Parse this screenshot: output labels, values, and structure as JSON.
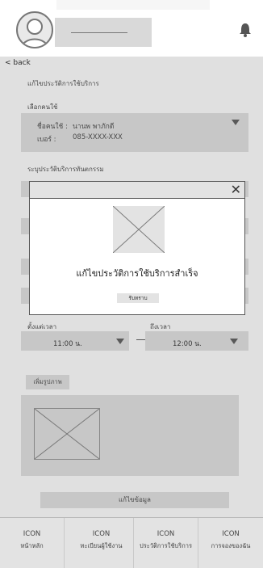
{
  "header": {
    "back_label": "< back",
    "name_placeholder": ""
  },
  "page": {
    "title": "แก้ไขประวัติการใช้บริการ",
    "select_user_label": "เลือกคนใช้",
    "maid_name_label": "ชื่อคนใช้ :",
    "maid_name_value": "นานพ พาภักดี",
    "phone_label": "เบอร์ :",
    "phone_value": "085-XXXX-XXX",
    "service_type_label": "ระบุประวัติบริการทันตกรรม",
    "start_time_label": "ตั้งแต่เวลา",
    "start_time_value": "11:00 น.",
    "end_time_label": "ถึงเวลา",
    "end_time_value": "12:00 น.",
    "time_separator": "—",
    "add_image_label": "เพิ่มรูปภาพ",
    "edit_button_label": "แก้ไขข้อมูล"
  },
  "modal": {
    "message": "แก้ไขประวัติการใช้บริการสำเร็จ",
    "ok_label": "รับทราบ",
    "close_glyph": "✕"
  },
  "bottom_nav": [
    {
      "icon_text": "ICON",
      "label": "หน้าหลัก"
    },
    {
      "icon_text": "ICON",
      "label": "ทะเบียนผู้ใช้งาน"
    },
    {
      "icon_text": "ICON",
      "label": "ประวัติการใช้บริการ"
    },
    {
      "icon_text": "ICON",
      "label": "การจองของฉัน"
    }
  ],
  "icons": {
    "bell": "bell-icon",
    "avatar": "user-avatar-icon",
    "dropdown": "chevron-down-icon",
    "image_placeholder": "image-placeholder-icon",
    "close": "close-icon"
  }
}
